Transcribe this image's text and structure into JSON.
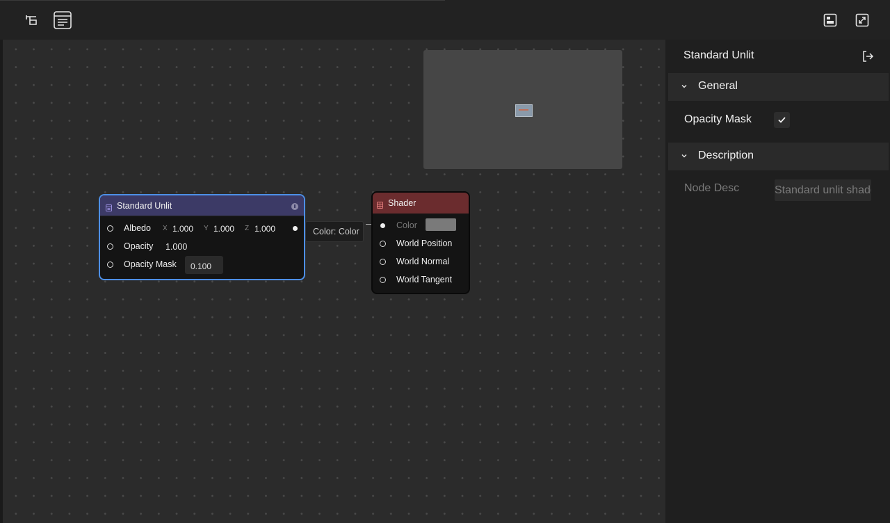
{
  "toolbar": {
    "left_buttons": [
      {
        "icon": "tree-layout-icon"
      },
      {
        "icon": "blackboard-icon"
      }
    ],
    "right_buttons": [
      {
        "icon": "layout-panel-icon"
      },
      {
        "icon": "fullscreen-icon"
      }
    ]
  },
  "graph": {
    "node_unlit": {
      "title": "Standard Unlit",
      "header_color": "#3c3a66",
      "border_color": "#4d8fe6",
      "rows": {
        "albedo": {
          "label": "Albedo",
          "x_axis": "X",
          "x": "1.000",
          "y_axis": "Y",
          "y": "1.000",
          "z_axis": "Z",
          "z": "1.000"
        },
        "opacity": {
          "label": "Opacity",
          "value": "1.000"
        },
        "opacity_mask": {
          "label": "Opacity Mask",
          "value": "0.100"
        }
      }
    },
    "tooltip": "Color: Color",
    "node_shader": {
      "title": "Shader",
      "header_color": "#6b2c2e",
      "rows": {
        "color": "Color",
        "world_position": "World Position",
        "world_normal": "World Normal",
        "world_tangent": "World Tangent"
      }
    }
  },
  "inspector": {
    "title": "Standard Unlit",
    "general": {
      "title": "General",
      "opacity_mask_label": "Opacity Mask",
      "opacity_mask_checked": true
    },
    "description": {
      "title": "Description",
      "node_desc_label": "Node Desc",
      "node_desc_value": "Standard unlit shader"
    }
  }
}
